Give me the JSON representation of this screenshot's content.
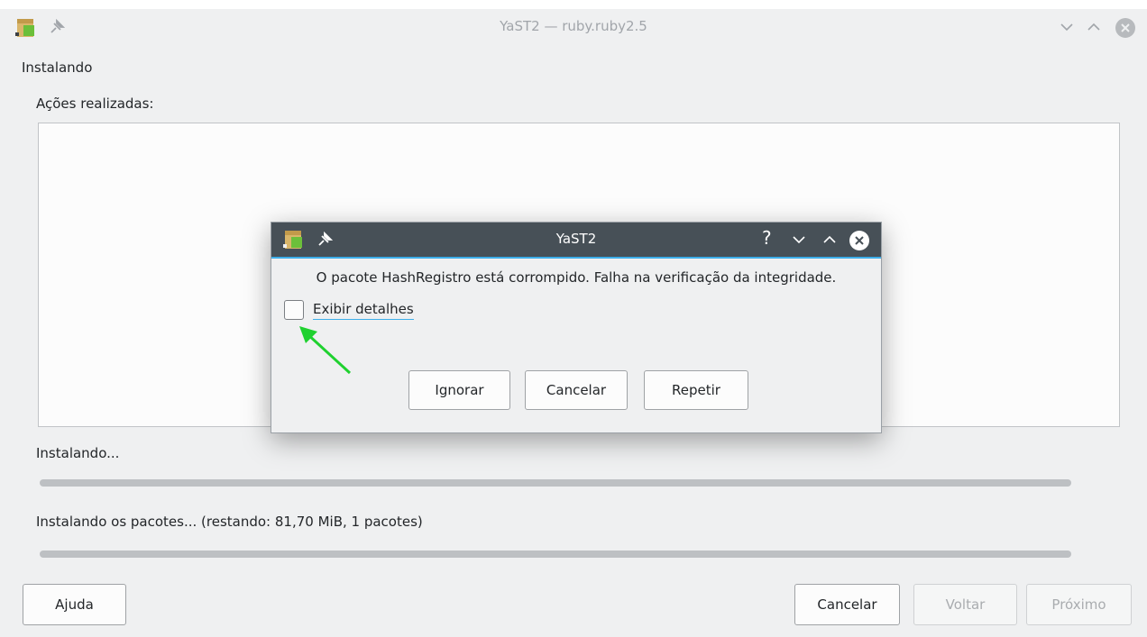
{
  "window": {
    "title": "YaST2 — ruby.ruby2.5",
    "section_title": "Instalando",
    "actions_label": "Ações realizadas:",
    "progress_label": "Instalando...",
    "packages_label": "Instalando os pacotes... (restando: 81,70 MiB, 1 pacotes)",
    "progress_installing": 0,
    "progress_packages": 0,
    "buttons": {
      "help": "Ajuda",
      "cancel": "Cancelar",
      "back": "Voltar",
      "next": "Próximo"
    }
  },
  "dialog": {
    "title": "YaST2",
    "help_glyph": "?",
    "message": "O pacote HashRegistro está corrompido. Falha na verificação da integridade.",
    "checkbox_label": "Exibir detalhes",
    "checkbox_checked": false,
    "buttons": {
      "ignore": "Ignorar",
      "cancel": "Cancelar",
      "retry": "Repetir"
    }
  },
  "icons": {
    "app": "yast-package-icon",
    "pin": "pin-icon",
    "minimize": "chevron-down-icon",
    "maximize": "chevron-up-icon",
    "close": "close-icon",
    "annotation": "green-arrow-icon"
  },
  "colors": {
    "accent": "#3daee9",
    "dialog_titlebar": "#475057",
    "annotation_arrow": "#1fd12f"
  }
}
